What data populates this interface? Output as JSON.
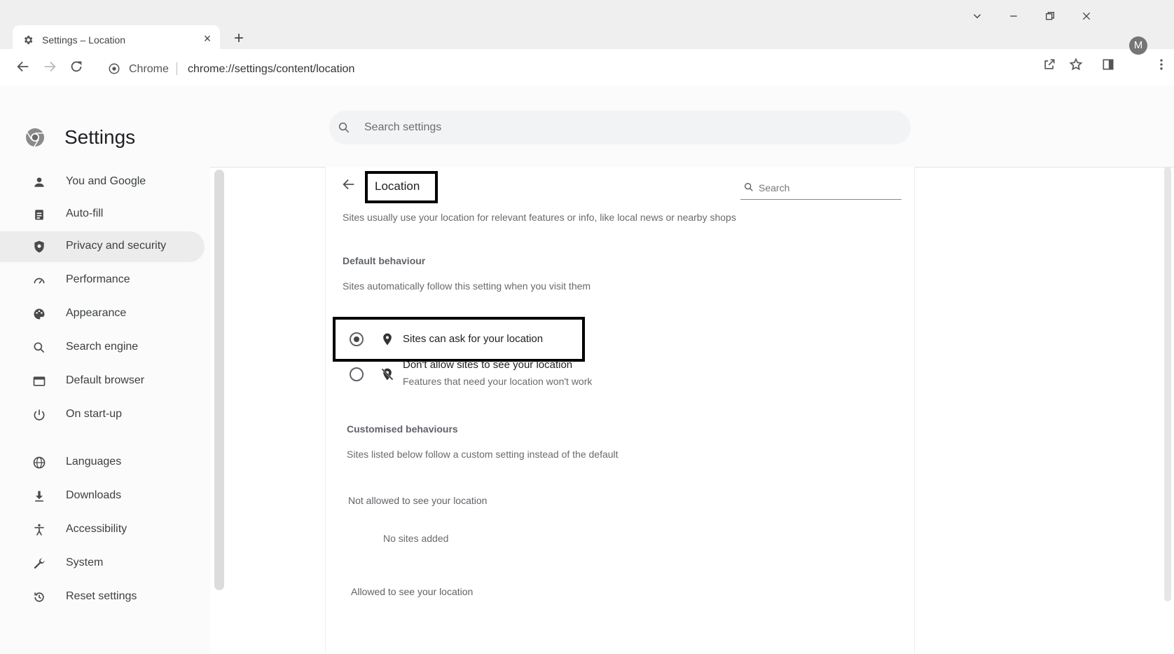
{
  "browser": {
    "tab_title": "Settings – Location",
    "tab_close": "×",
    "new_tab": "+",
    "site_label": "Chrome",
    "url": "chrome://settings/content/location",
    "avatar_letter": "M"
  },
  "header": {
    "title": "Settings",
    "search_placeholder": "Search settings"
  },
  "sidebar": {
    "items": [
      {
        "label": "You and Google",
        "icon": "person-icon"
      },
      {
        "label": "Auto-fill",
        "icon": "clipboard-icon"
      },
      {
        "label": "Privacy and security",
        "icon": "shield-icon",
        "active": true
      },
      {
        "label": "Performance",
        "icon": "gauge-icon"
      },
      {
        "label": "Appearance",
        "icon": "palette-icon"
      },
      {
        "label": "Search engine",
        "icon": "search-icon"
      },
      {
        "label": "Default browser",
        "icon": "browser-window-icon"
      },
      {
        "label": "On start-up",
        "icon": "power-icon"
      },
      {
        "label": "Languages",
        "icon": "globe-icon"
      },
      {
        "label": "Downloads",
        "icon": "download-icon"
      },
      {
        "label": "Accessibility",
        "icon": "accessibility-icon"
      },
      {
        "label": "System",
        "icon": "wrench-icon"
      },
      {
        "label": "Reset settings",
        "icon": "restore-icon"
      }
    ]
  },
  "location": {
    "title": "Location",
    "search_placeholder": "Search",
    "intro": "Sites usually use your location for relevant features or info, like local news or nearby shops",
    "default_heading": "Default behaviour",
    "default_desc": "Sites automatically follow this setting when you visit them",
    "option_ask": "Sites can ask for your location",
    "option_block": "Don't allow sites to see your location",
    "option_block_sub": "Features that need your location won't work",
    "selected_option": "ask",
    "custom_heading": "Customised behaviours",
    "custom_desc": "Sites listed below follow a custom setting instead of the default",
    "not_allowed_heading": "Not allowed to see your location",
    "no_sites": "No sites added",
    "allowed_heading": "Allowed to see your location"
  }
}
